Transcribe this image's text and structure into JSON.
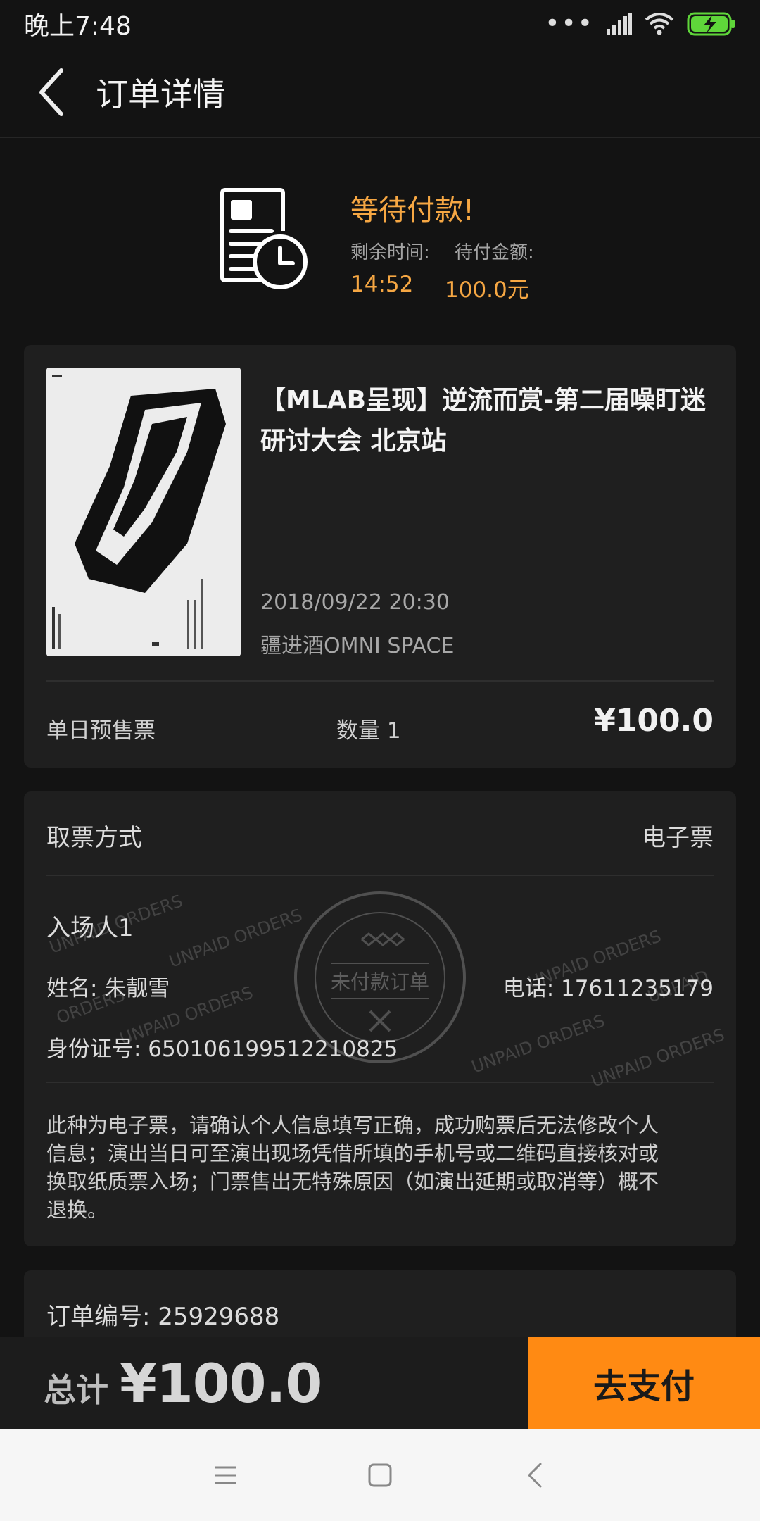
{
  "status_bar": {
    "time": "晚上7:48",
    "icons": [
      "more-dots-icon",
      "signal-icon",
      "wifi-icon",
      "battery-charging-icon"
    ]
  },
  "nav": {
    "title": "订单详情",
    "back_icon": "chevron-left-icon"
  },
  "pay_status": {
    "title": "等待付款!",
    "remaining_label": "剩余时间:",
    "amount_label": "待付金额:",
    "remaining_value": "14:52",
    "amount_value": "100.0元",
    "accent_color": "#f6a743"
  },
  "event": {
    "title": "【MLAB呈现】逆流而赏-第二届噪盯迷研讨大会 北京站",
    "datetime": "2018/09/22 20:30",
    "venue": "疆进酒OMNI SPACE",
    "ticket_type": "单日预售票",
    "quantity": "数量 1",
    "price": "¥100.0",
    "poster_icon": "event-poster-image"
  },
  "ticket_info": {
    "pickup_label": "取票方式",
    "pickup_value": "电子票",
    "attendee_heading": "入场人1",
    "name": "姓名: 朱靓雪",
    "phone": "电话: 17611235179",
    "id_number": "身份证号: 650106199512210825",
    "notice": "此种为电子票，请确认个人信息填写正确，成功购票后无法修改个人信息；演出当日可至演出现场凭借所填的手机号或二维码直接核对或换取纸质票入场；门票售出无特殊原因（如演出延期或取消等）概不退换。",
    "stamp_text": "未付款订单",
    "watermark_text": "UNPAID ORDERS"
  },
  "order": {
    "number": "订单编号: 25929688"
  },
  "pay_bar": {
    "total_label": "总计",
    "total_value": "¥100.0",
    "pay_button": "去支付",
    "button_color": "#ff8a13"
  },
  "system_nav": {
    "icons": [
      "menu-icon",
      "home-square-icon",
      "back-chevron-icon"
    ]
  }
}
